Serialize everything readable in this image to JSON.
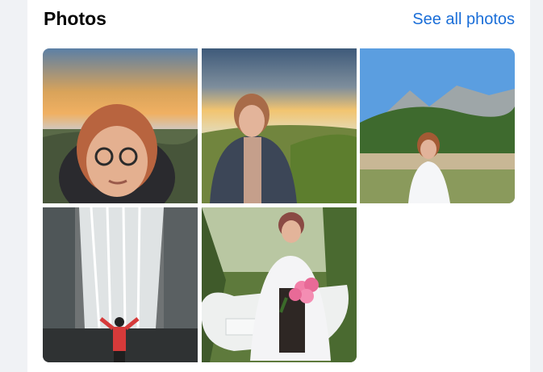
{
  "section": {
    "title": "Photos",
    "see_all_label": "See all photos"
  },
  "colors": {
    "link": "#1a6ed8",
    "card": "#ffffff",
    "page_bg": "#f0f2f5"
  },
  "photos": [
    {
      "kind": "sunset-selfie-above-clouds"
    },
    {
      "kind": "woman-standing-at-sunset-hillside"
    },
    {
      "kind": "woman-in-white-mountains-blue-sky"
    },
    {
      "kind": "person-in-red-before-waterfall"
    },
    {
      "kind": "woman-seated-on-white-boat-with-peonies"
    }
  ]
}
